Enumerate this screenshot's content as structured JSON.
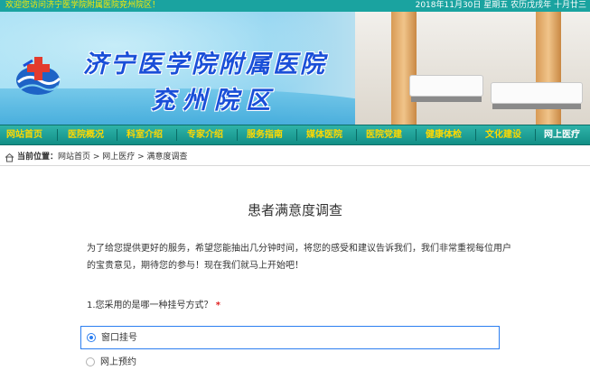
{
  "topbar": {
    "welcome": "欢迎您访问济宁医学院附属医院兖州院区！",
    "date": "2018年11月30日 星期五 农历戊戌年 十月廿三"
  },
  "banner": {
    "title_line1": "济宁医学院附属医院",
    "title_line2": "兖州院区",
    "logo_icon": "hospital-logo-icon"
  },
  "nav": {
    "items": [
      {
        "label": "网站首页"
      },
      {
        "label": "医院概况"
      },
      {
        "label": "科室介绍"
      },
      {
        "label": "专家介绍"
      },
      {
        "label": "服务指南"
      },
      {
        "label": "媒体医院"
      },
      {
        "label": "医院党建"
      },
      {
        "label": "健康体检"
      },
      {
        "label": "文化建设"
      },
      {
        "label": "网上医疗",
        "active": true
      }
    ],
    "text_color": "#ffd900",
    "active_color": "#ffffff",
    "bg_color": "#1aa39a"
  },
  "breadcrumb": {
    "prefix": "当前位置：",
    "path": "网站首页 > 网上医疗 > 满意度调查",
    "icon": "home-icon"
  },
  "survey": {
    "title": "患者满意度调查",
    "intro": "为了给您提供更好的服务，希望您能抽出几分钟时间，将您的感受和建议告诉我们，我们非常重视每位用户的宝贵意见，期待您的参与！现在我们就马上开始吧！",
    "question": "1.您采用的是哪一种挂号方式？",
    "required_mark": "*",
    "options": [
      {
        "label": "窗口挂号",
        "selected": true
      },
      {
        "label": "网上预约",
        "selected": false
      }
    ],
    "accent_color": "#2c7ef0"
  }
}
